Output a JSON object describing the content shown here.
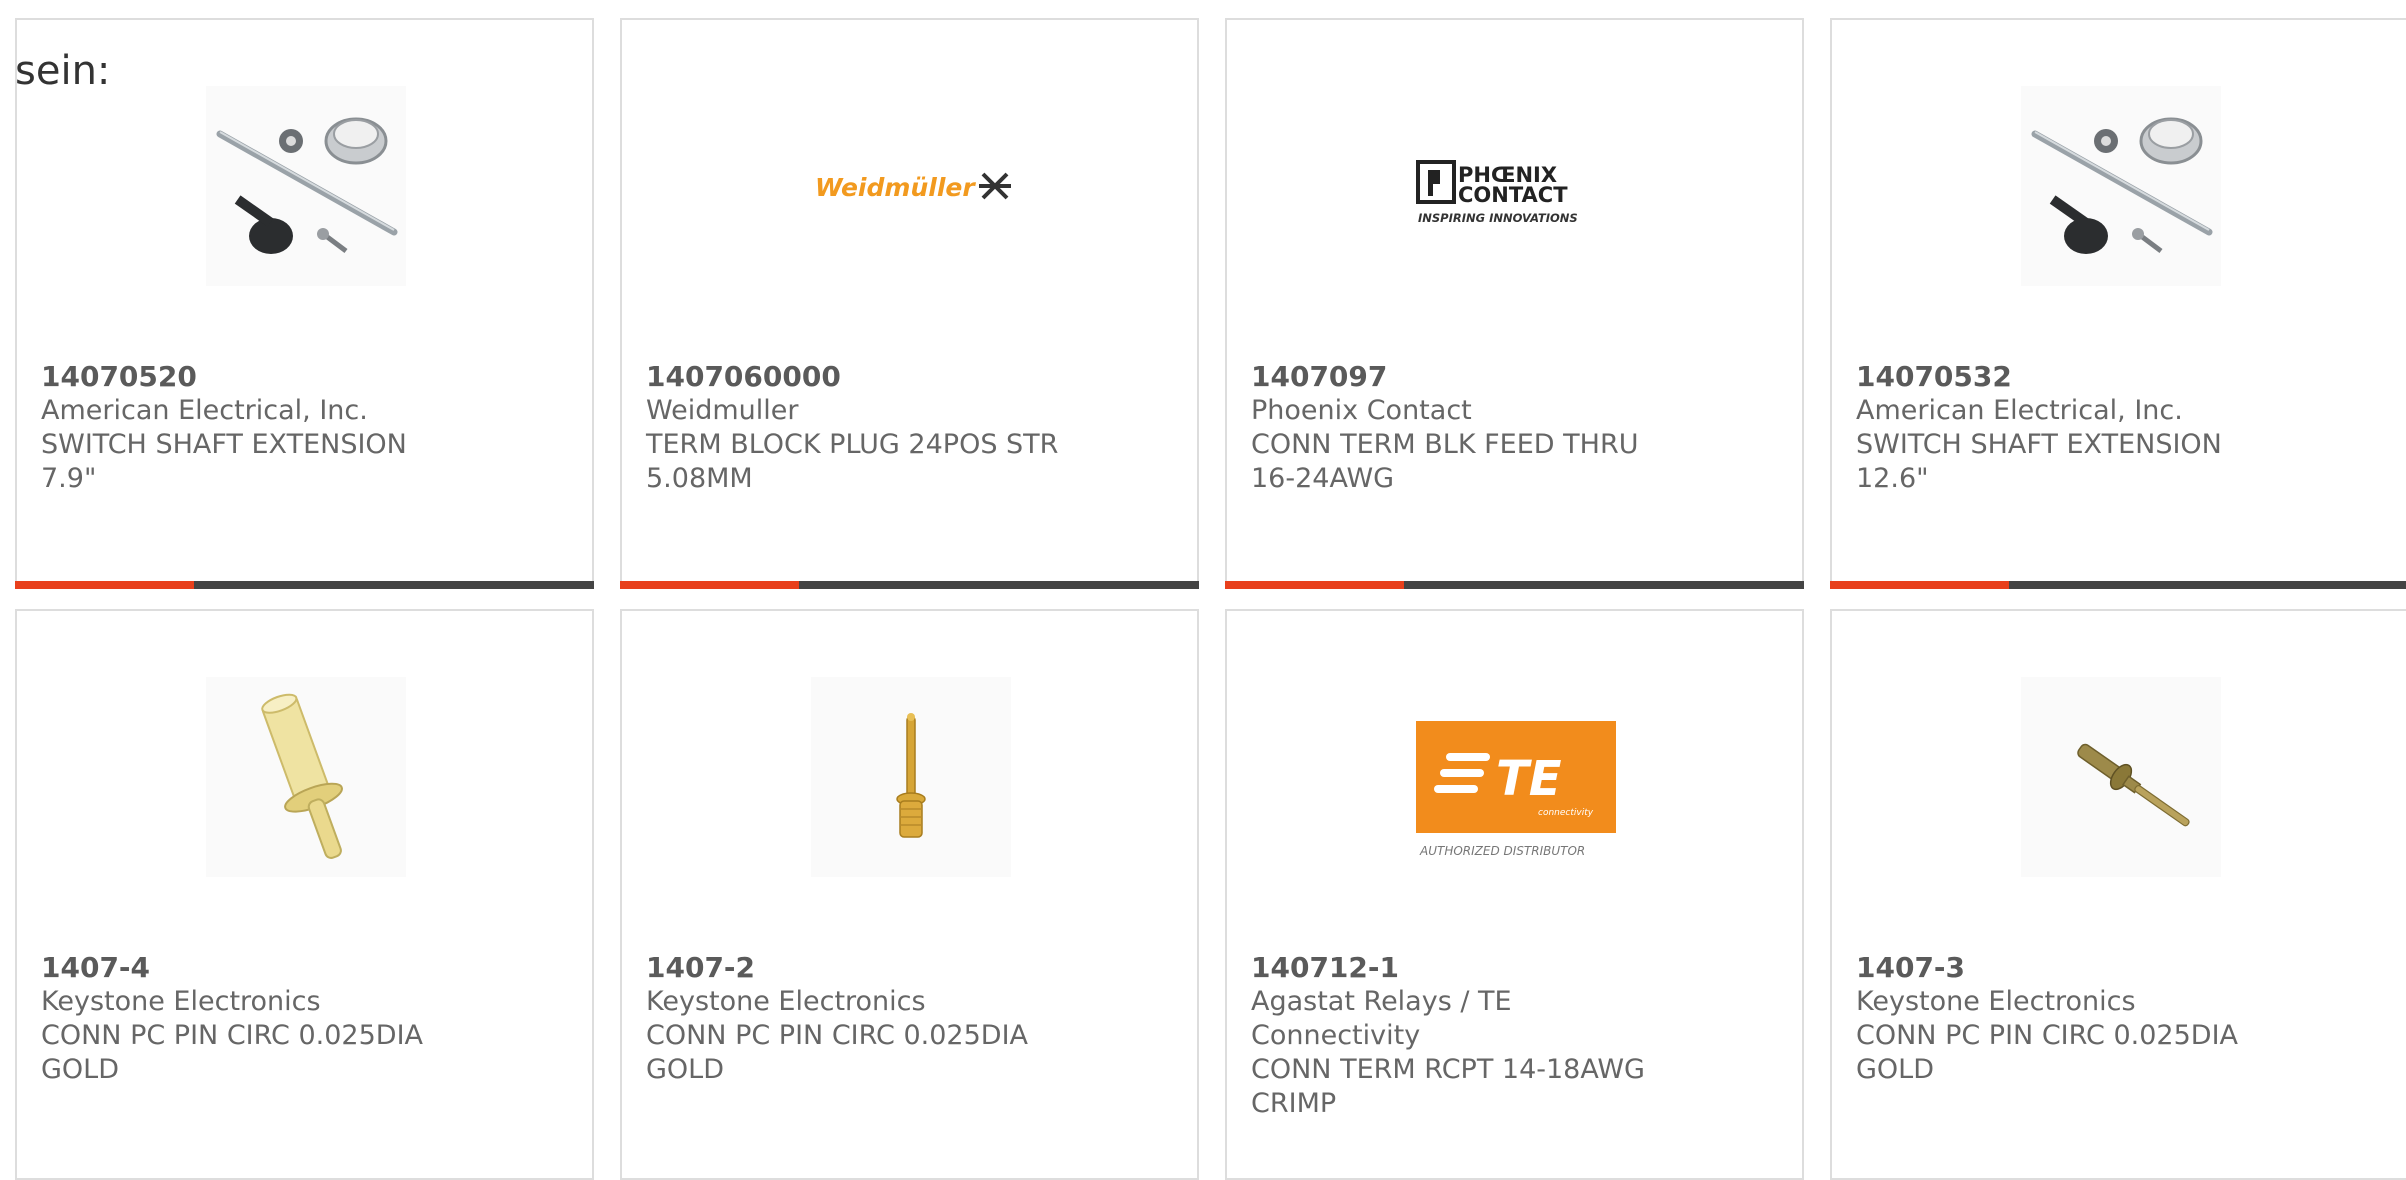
{
  "heading": "sein:",
  "colors": {
    "accent": "#e8401c",
    "progress_track": "#444444",
    "card_border": "#dddddd",
    "text": "#666666"
  },
  "cards": [
    {
      "part_number": "14070520",
      "manufacturer": "American Electrical, Inc.",
      "description": "SWITCH SHAFT EXTENSION 7.9\"",
      "image_icon": "switch-shaft-extension-kit-icon",
      "progress": 0.31
    },
    {
      "part_number": "1407060000",
      "manufacturer": "Weidmuller",
      "description": "TERM BLOCK PLUG 24POS STR 5.08MM",
      "image_icon": "weidmuller-logo",
      "logo_text": "Weidmüller",
      "progress": 0.31
    },
    {
      "part_number": "1407097",
      "manufacturer": "Phoenix Contact",
      "description": "CONN TERM BLK FEED THRU 16-24AWG",
      "image_icon": "phoenix-contact-logo",
      "logo_text_1": "PHŒNIX",
      "logo_text_2": "CONTACT",
      "logo_text_3": "INSPIRING INNOVATIONS",
      "progress": 0.31
    },
    {
      "part_number": "14070532",
      "manufacturer": "American Electrical, Inc.",
      "description": "SWITCH SHAFT EXTENSION 12.6\"",
      "image_icon": "switch-shaft-extension-kit-icon",
      "progress": 0.31
    },
    {
      "part_number": "1407-4",
      "manufacturer": "Keystone Electronics",
      "description": "CONN PC PIN CIRC 0.025DIA GOLD",
      "image_icon": "gold-pc-pin-large-icon"
    },
    {
      "part_number": "1407-2",
      "manufacturer": "Keystone Electronics",
      "description": "CONN PC PIN CIRC 0.025DIA GOLD",
      "image_icon": "gold-pc-pin-vertical-icon"
    },
    {
      "part_number": "140712-1",
      "manufacturer": "Agastat Relays / TE Connectivity",
      "description": "CONN TERM RCPT 14-18AWG CRIMP",
      "image_icon": "te-connectivity-logo",
      "logo_text_1": "TE",
      "logo_text_2": "connectivity",
      "logo_text_3": "AUTHORIZED DISTRIBUTOR"
    },
    {
      "part_number": "1407-3",
      "manufacturer": "Keystone Electronics",
      "description": "CONN PC PIN CIRC 0.025DIA GOLD",
      "image_icon": "gold-pc-pin-diagonal-icon"
    }
  ]
}
